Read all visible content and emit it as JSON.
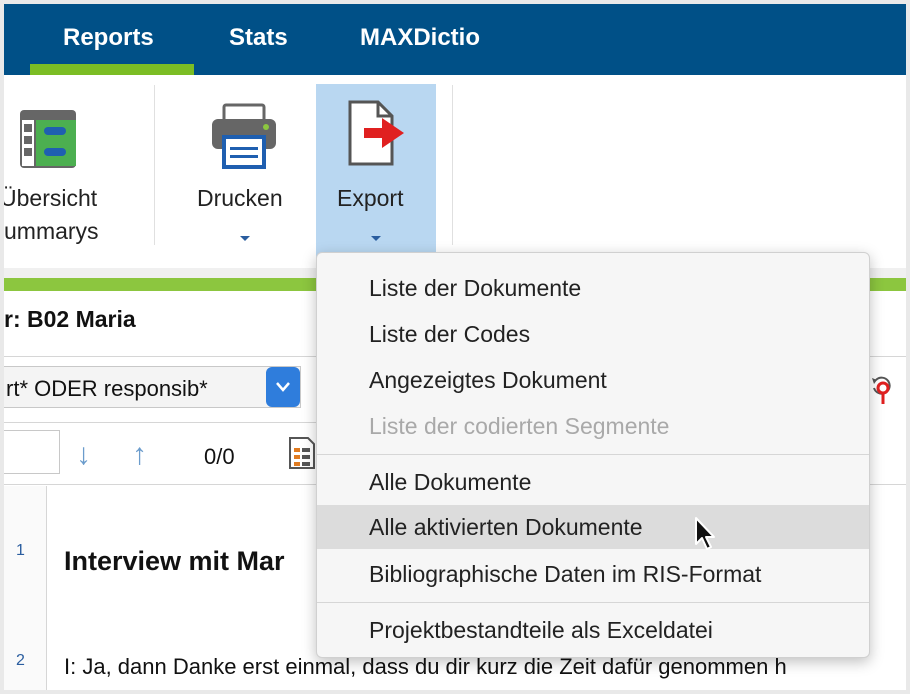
{
  "tabs": [
    {
      "label": "Reports",
      "active": true
    },
    {
      "label": "Stats"
    },
    {
      "label": "MAXDictio"
    }
  ],
  "ribbon": {
    "overview_label_line1": "Übersicht",
    "overview_label_line2": "ummarys",
    "print_label": "Drucken",
    "export_label": "Export"
  },
  "document": {
    "title_prefix": "r: ",
    "title_name": "B02 Maria",
    "search_value": "rt* ODER responsib*",
    "counter": "0/0",
    "line_numbers": [
      "1",
      "2"
    ],
    "interview_title": "Interview mit Mar",
    "body_text": "I: Ja, dann Danke erst einmal, dass du dir kurz die Zeit dafür genommen h"
  },
  "export_menu": {
    "groups": [
      [
        {
          "label": "Liste der Dokumente",
          "enabled": true
        },
        {
          "label": "Liste der Codes",
          "enabled": true
        },
        {
          "label": "Angezeigtes Dokument",
          "enabled": true
        },
        {
          "label": "Liste der codierten Segmente",
          "enabled": false
        }
      ],
      [
        {
          "label": "Alle Dokumente",
          "enabled": true
        },
        {
          "label": "Alle aktivierten Dokumente",
          "enabled": true,
          "hovered": true
        },
        {
          "label": "Bibliographische Daten im RIS-Format",
          "enabled": true
        }
      ],
      [
        {
          "label": "Projektbestandteile als Exceldatei",
          "enabled": true
        }
      ]
    ]
  },
  "colors": {
    "tabbar": "#005087",
    "accent_green": "#7bbd24",
    "export_highlight": "#b9d7f1",
    "export_arrow": "#e02020"
  },
  "icons": [
    "overview-table-icon",
    "printer-icon",
    "export-file-icon",
    "chevron-down-icon",
    "arrow-down-icon",
    "arrow-up-icon",
    "report-icon",
    "reset-pin-icon",
    "mouse-pointer-icon"
  ]
}
